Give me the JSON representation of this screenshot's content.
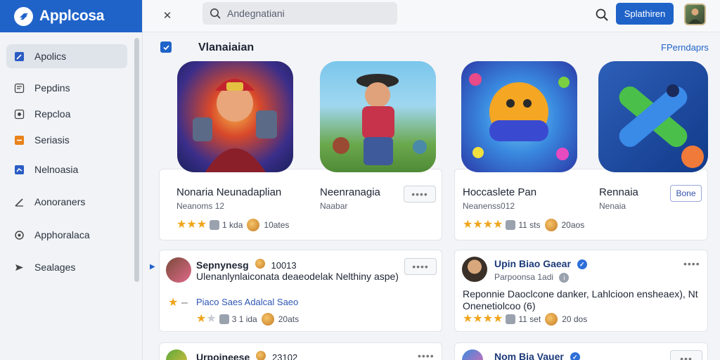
{
  "brand": {
    "title": "Applcosa"
  },
  "sidebar": {
    "items": [
      {
        "label": "Apolics",
        "icon": "edit-icon",
        "active": true
      },
      {
        "label": "Pepdins",
        "icon": "document-icon"
      },
      {
        "label": "Repcloa",
        "icon": "bookmark-icon"
      },
      {
        "label": "Seriasis",
        "icon": "tag-icon"
      },
      {
        "label": "Nelnoasia",
        "icon": "chart-icon"
      },
      {
        "label": "Aonoraners",
        "icon": "pen-icon"
      },
      {
        "label": "Apphoralaca",
        "icon": "gear-icon"
      },
      {
        "label": "Sealages",
        "icon": "send-icon"
      }
    ]
  },
  "topbar": {
    "search_placeholder": "Andegnatiani",
    "primary_button": "Splathiren"
  },
  "main": {
    "section_title": "Vlanaiaian",
    "section_link": "FPerndaprs",
    "apps": [
      {
        "name": "Nonaria Neunadaplian",
        "sub": "Neanoms 12",
        "rating_text": "1 kda",
        "coins": "10ates",
        "stars": 3,
        "button": ""
      },
      {
        "name": "Neenranagia",
        "sub": "Naabar",
        "rating_text": "",
        "coins": "",
        "stars": 0,
        "button": "••••"
      },
      {
        "name": "Hoccaslete Pan",
        "sub": "Neanenss012",
        "rating_text": "11 sts",
        "coins": "20aos",
        "stars": 4,
        "button": ""
      },
      {
        "name": "Rennaia",
        "sub": "Nenaia",
        "rating_text": "",
        "coins": "",
        "stars": 0,
        "button": "Bone"
      }
    ],
    "developers": [
      {
        "name": "Sepnynesg",
        "count": "10013",
        "desc": "Ulenanlynlaiconata deaeodelak Nelthiny aspe)",
        "link": "Piaco Saes Adalcal Saeo",
        "rating_text": "3 1 ida",
        "coins": "20ats",
        "stars": 2,
        "button": "••••"
      },
      {
        "name": "Upin Biao Gaear",
        "sub": "Parpoonsa 1adi",
        "desc": "Reponnie Daoclcone danker, Lahlcioon ensheaex), Nt Onenetiolcoo (6)",
        "rating_text": "11 set",
        "coins": "20 dos",
        "stars": 4,
        "button": "••••"
      },
      {
        "name": "Urpoineese",
        "count": "23102",
        "button": "••••"
      },
      {
        "name": "Nom Bia Vauer",
        "button": "•••"
      }
    ]
  },
  "colors": {
    "accent": "#1f63c9",
    "star": "#f0a51c"
  }
}
